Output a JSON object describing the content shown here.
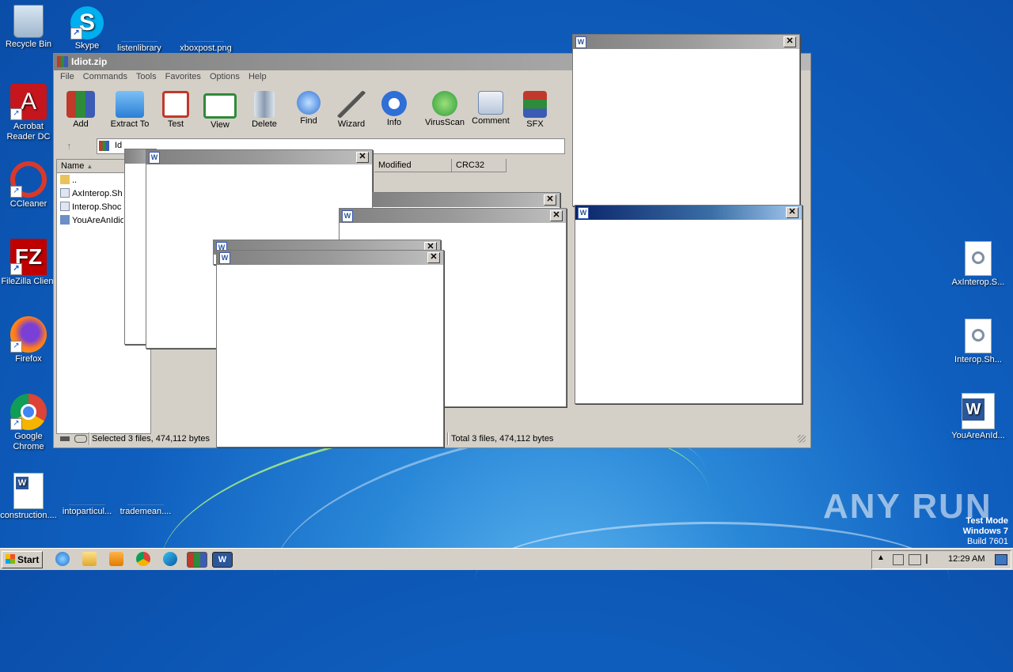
{
  "desktop": {
    "icons_left": [
      {
        "label": "Recycle Bin",
        "icon": "recycle-bin-icon"
      },
      {
        "label": "Acrobat Reader DC",
        "line2": "Reader DC",
        "line1": "Acrobat",
        "icon": "acrobat-icon"
      },
      {
        "label": "CCleaner",
        "icon": "ccleaner-icon"
      },
      {
        "label": "FileZilla Client",
        "icon": "filezilla-icon"
      },
      {
        "label": "Firefox",
        "icon": "firefox-icon"
      },
      {
        "label": "Google Chrome",
        "line1": "Google",
        "line2": "Chrome",
        "icon": "chrome-icon"
      },
      {
        "label": "construction....",
        "icon": "word-doc-icon"
      }
    ],
    "icons_top": [
      {
        "label": "Skype",
        "icon": "skype-icon"
      },
      {
        "label": "listenlibrary",
        "icon": "file-icon"
      },
      {
        "label": "xboxpost.png",
        "icon": "file-icon"
      }
    ],
    "icons_bottom": [
      {
        "label": "intoparticul...",
        "icon": "file-icon"
      },
      {
        "label": "trademean....",
        "icon": "file-icon"
      }
    ],
    "icons_right": [
      {
        "label": "AxInterop.S...",
        "icon": "dll-icon"
      },
      {
        "label": "Interop.Sh...",
        "icon": "dll-icon"
      },
      {
        "label": "YouAreAnId...",
        "icon": "word-icon"
      }
    ],
    "watermark": {
      "brand": "ANY RUN",
      "mode": "Test Mode",
      "os": "Windows 7",
      "build": "Build 7601"
    }
  },
  "winrar": {
    "title": "Idiot.zip",
    "menu": [
      "File",
      "Commands",
      "Tools",
      "Favorites",
      "Options",
      "Help"
    ],
    "toolbar": [
      {
        "label": "Add",
        "icon": "add-archive-icon",
        "color": "#c0392b"
      },
      {
        "label": "Extract To",
        "icon": "extract-folder-icon",
        "color": "#3b8fe0"
      },
      {
        "label": "Test",
        "icon": "test-clipboard-icon",
        "color": "#c0392b"
      },
      {
        "label": "View",
        "icon": "view-book-icon",
        "color": "#2e8b3a"
      },
      {
        "label": "Delete",
        "icon": "delete-trash-icon",
        "color": "#8a9bb0"
      },
      {
        "label": "Find",
        "icon": "find-magnifier-icon",
        "color": "#2f6fd6"
      },
      {
        "label": "Wizard",
        "icon": "wizard-wand-icon",
        "color": "#7ac143"
      },
      {
        "label": "Info",
        "icon": "info-icon",
        "color": "#2f6fd6"
      },
      {
        "label": "VirusScan",
        "icon": "virusscan-icon",
        "color": "#2e9b3a"
      },
      {
        "label": "Comment",
        "icon": "comment-icon",
        "color": "#6e88b0"
      },
      {
        "label": "SFX",
        "icon": "sfx-icon",
        "color": "#c0392b"
      }
    ],
    "address": "Id",
    "columns": [
      "Name",
      "Modified",
      "CRC32"
    ],
    "files": [
      {
        "name": "..",
        "icon": "folder-up-icon"
      },
      {
        "name": "AxInterop.Sh",
        "icon": "dll-file-icon"
      },
      {
        "name": "Interop.Shoc",
        "icon": "dll-file-icon"
      },
      {
        "name": "YouAreAnIdio",
        "icon": "exe-file-icon"
      }
    ],
    "status_left": "Selected 3 files, 474,112 bytes",
    "status_right": "Total 3 files, 474,112 bytes"
  },
  "taskbar": {
    "start_label": "Start",
    "clock": "12:29 AM",
    "pinned": [
      "ie-icon",
      "explorer-icon",
      "media-player-icon",
      "chrome-icon",
      "edge-icon",
      "winrar-icon",
      "word-icon"
    ]
  },
  "popup_close_label": "✕"
}
